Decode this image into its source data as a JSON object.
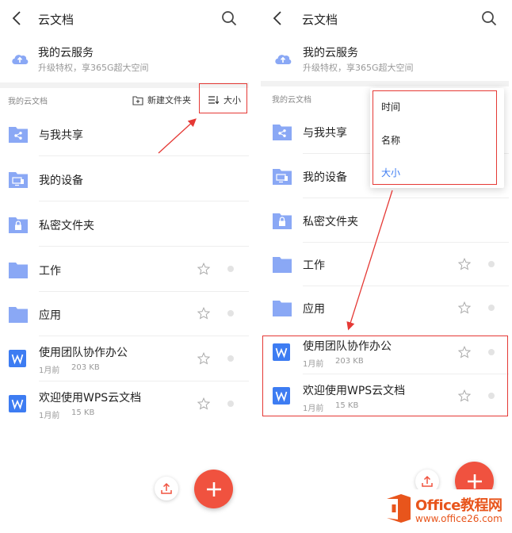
{
  "left": {
    "app_title": "云文档",
    "service_name": "我的云服务",
    "service_sub": "升级特权，享365G超大空间",
    "section_label": "我的云文档",
    "new_folder_label": "新建文件夹",
    "sort_label": "大小",
    "items": [
      {
        "name": "与我共享",
        "icon": "shared-folder-icon"
      },
      {
        "name": "我的设备",
        "icon": "device-folder-icon"
      },
      {
        "name": "私密文件夹",
        "icon": "lock-folder-icon"
      },
      {
        "name": "工作",
        "icon": "folder-icon"
      },
      {
        "name": "应用",
        "icon": "folder-icon"
      },
      {
        "name": "使用团队协作办公",
        "icon": "wps-doc-icon",
        "time": "1月前",
        "size": "203 KB"
      },
      {
        "name": "欢迎使用WPS云文档",
        "icon": "wps-doc-icon",
        "time": "1月前",
        "size": "15 KB"
      }
    ]
  },
  "right": {
    "app_title": "云文档",
    "service_name": "我的云服务",
    "service_sub": "升级特权，享365G超大空间",
    "section_label": "我的云文档",
    "sort_menu": [
      "时间",
      "名称",
      "大小"
    ],
    "sort_menu_active": "大小",
    "items": [
      {
        "name": "与我共享",
        "icon": "shared-folder-icon"
      },
      {
        "name": "我的设备",
        "icon": "device-folder-icon"
      },
      {
        "name": "私密文件夹",
        "icon": "lock-folder-icon"
      },
      {
        "name": "工作",
        "icon": "folder-icon"
      },
      {
        "name": "应用",
        "icon": "folder-icon"
      },
      {
        "name": "使用团队协作办公",
        "icon": "wps-doc-icon",
        "time": "1月前",
        "size": "203 KB"
      },
      {
        "name": "欢迎使用WPS云文档",
        "icon": "wps-doc-icon",
        "time": "1月前",
        "size": "15 KB"
      }
    ]
  },
  "watermark": {
    "brand": "Office教程网",
    "url": "www.office26.com"
  },
  "colors": {
    "accent_blue": "#3d7cf2",
    "folder_blue": "#8aa8f5",
    "fab_red": "#f0523f",
    "annotation_red": "#e53935"
  }
}
